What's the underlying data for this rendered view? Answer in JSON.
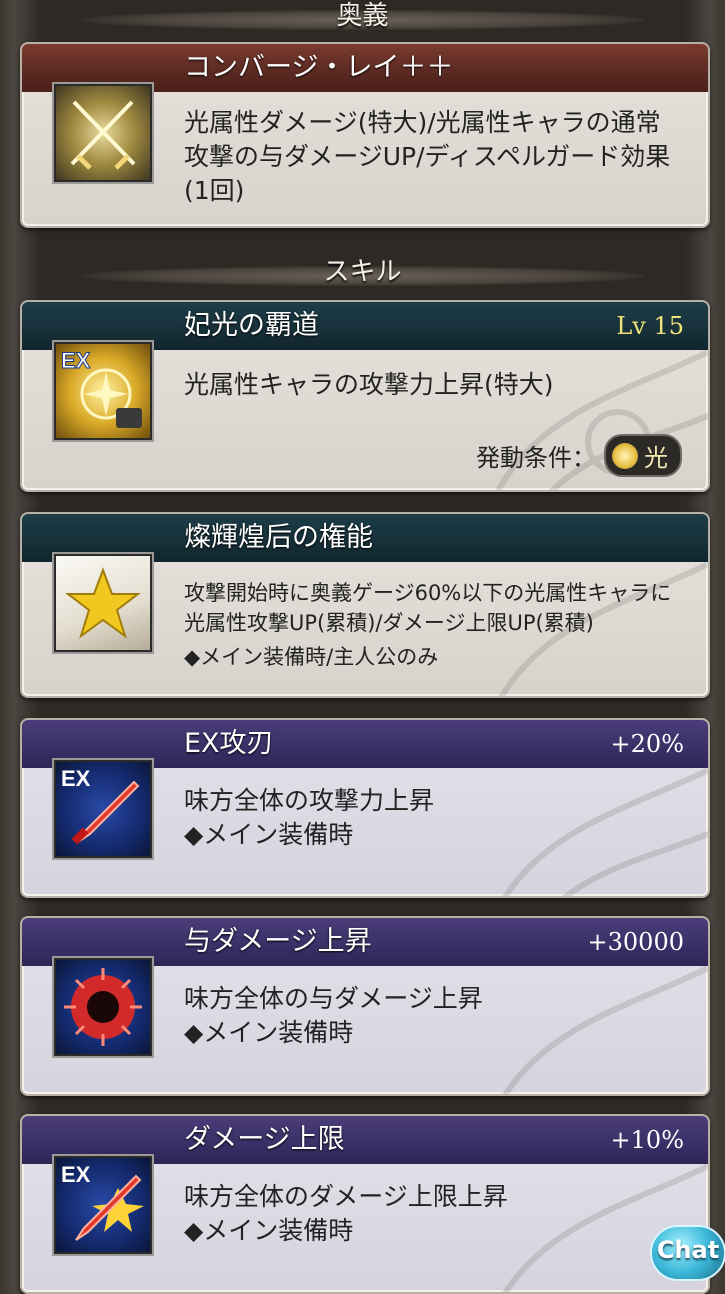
{
  "ougi_section": {
    "heading": "奥義"
  },
  "ougi": {
    "name": "コンバージ・レイ＋＋",
    "icon": "crossed-swords-light-icon",
    "description": "光属性ダメージ(特大)/光属性キャラの通常攻撃の与ダメージUP/ディスペルガード効果(1回)"
  },
  "skill_section": {
    "heading": "スキル"
  },
  "skills": [
    {
      "name": "妃光の覇道",
      "right": "Lv 15",
      "icon": "ex-light-sun-icon",
      "description": "光属性キャラの攻撃力上昇(特大)",
      "condition_label": "発動条件：",
      "condition_value": "光"
    },
    {
      "name": "燦輝煌后の権能",
      "right": "",
      "icon": "gold-star-icon",
      "description": "攻撃開始時に奥義ゲージ60%以下の光属性キャラに光属性攻撃UP(累積)/ダメージ上限UP(累積)",
      "note": "◆メイン装備時/主人公のみ"
    },
    {
      "name": "EX攻刃",
      "right": "+20%",
      "icon": "ex-red-blade-icon",
      "description": "味方全体の攻撃力上昇",
      "note": "◆メイン装備時"
    },
    {
      "name": "与ダメージ上昇",
      "right": "+30000",
      "icon": "red-burst-icon",
      "description": "味方全体の与ダメージ上昇",
      "note": "◆メイン装備時"
    },
    {
      "name": "ダメージ上限",
      "right": "+10%",
      "icon": "ex-blade-star-icon",
      "description": "味方全体のダメージ上限上昇",
      "note": "◆メイン装備時"
    }
  ],
  "chat_button": {
    "label": "Chat"
  }
}
